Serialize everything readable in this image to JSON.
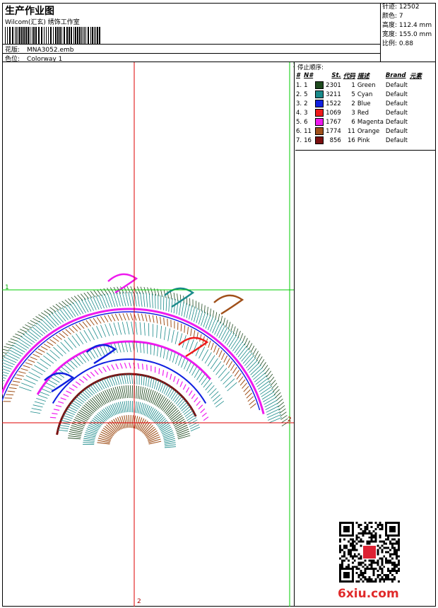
{
  "header": {
    "title": "生产作业图",
    "subtitle": "Wilcom(汇玄) 绣饰工作室",
    "design_label": "花版:",
    "design_value": "MNA3052.emb",
    "colorway_label": "色位:",
    "colorway_value": "Colorway 1"
  },
  "stats": [
    {
      "label": "针迹:",
      "value": "12502"
    },
    {
      "label": "颜色:",
      "value": "7"
    },
    {
      "label": "高度:",
      "value": "112.4 mm"
    },
    {
      "label": "宽度:",
      "value": "155.0 mm"
    },
    {
      "label": "比例:",
      "value": "0.88"
    }
  ],
  "color_table": {
    "heading": "停止顺序:",
    "columns": [
      "#",
      "N#",
      "St.",
      "代码",
      "描述",
      "Brand",
      "元素"
    ],
    "rows": [
      {
        "idx": "1.",
        "n": "1",
        "st": "2301",
        "code": "1",
        "desc": "Green",
        "brand": "Default",
        "color": "#1f4a1f"
      },
      {
        "idx": "2.",
        "n": "5",
        "st": "3211",
        "code": "5",
        "desc": "Cyan",
        "brand": "Default",
        "color": "#1a8a8a"
      },
      {
        "idx": "3.",
        "n": "2",
        "st": "1522",
        "code": "2",
        "desc": "Blue",
        "brand": "Default",
        "color": "#1020e0"
      },
      {
        "idx": "4.",
        "n": "3",
        "st": "1069",
        "code": "3",
        "desc": "Red",
        "brand": "Default",
        "color": "#ee1a1a"
      },
      {
        "idx": "5.",
        "n": "6",
        "st": "1767",
        "code": "6",
        "desc": "Magenta",
        "brand": "Default",
        "color": "#ee1aee"
      },
      {
        "idx": "6.",
        "n": "11",
        "st": "1774",
        "code": "11",
        "desc": "Orange",
        "brand": "Default",
        "color": "#a0501a"
      },
      {
        "idx": "7.",
        "n": "16",
        "st": "856",
        "code": "16",
        "desc": "Pink",
        "brand": "Default",
        "color": "#7a1010"
      }
    ]
  },
  "guides": {
    "h1": "1",
    "v1": "1",
    "h2": "2",
    "v2": "2"
  },
  "watermark": "6xiu.com"
}
